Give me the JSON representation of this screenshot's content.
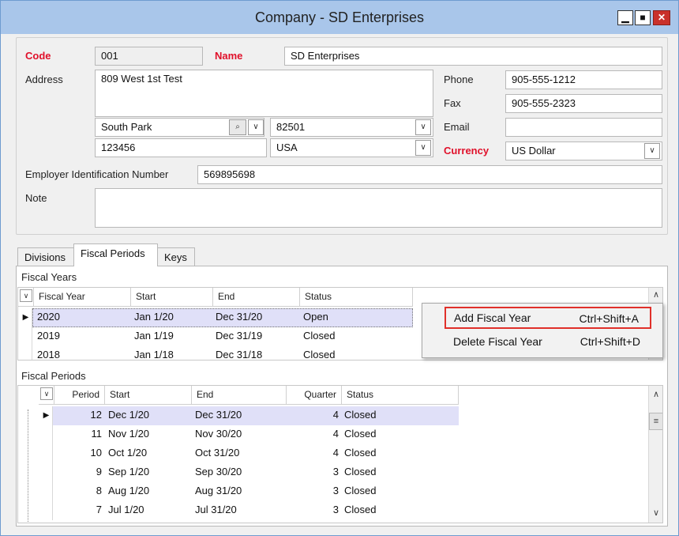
{
  "window": {
    "title": "Company - SD Enterprises",
    "min_glyph": "▁",
    "max_glyph": "■",
    "close_glyph": "✕"
  },
  "form": {
    "code_label": "Code",
    "code_value": "001",
    "name_label": "Name",
    "name_value": "SD Enterprises",
    "address_label": "Address",
    "address_value": "809 West 1st Test",
    "city_value": "South Park",
    "zip_value": "82501",
    "postal_value": "123456",
    "country_value": "USA",
    "phone_label": "Phone",
    "phone_value": "905-555-1212",
    "fax_label": "Fax",
    "fax_value": "905-555-2323",
    "email_label": "Email",
    "email_value": "",
    "currency_label": "Currency",
    "currency_value": "US Dollar",
    "ein_label": "Employer Identification Number",
    "ein_value": "569895698",
    "note_label": "Note",
    "note_value": ""
  },
  "tabs": [
    {
      "label": "Divisions"
    },
    {
      "label": "Fiscal Periods"
    },
    {
      "label": "Keys"
    }
  ],
  "fiscal_years": {
    "title": "Fiscal Years",
    "columns": [
      "Fiscal Year",
      "Start",
      "End",
      "Status"
    ],
    "rows": [
      {
        "year": "2020",
        "start": "Jan 1/20",
        "end": "Dec 31/20",
        "status": "Open"
      },
      {
        "year": "2019",
        "start": "Jan 1/19",
        "end": "Dec 31/19",
        "status": "Closed"
      },
      {
        "year": "2018",
        "start": "Jan 1/18",
        "end": "Dec 31/18",
        "status": "Closed"
      }
    ]
  },
  "fiscal_periods": {
    "title": "Fiscal Periods",
    "columns": [
      "Period",
      "Start",
      "End",
      "Quarter",
      "Status"
    ],
    "rows": [
      {
        "period": "12",
        "start": "Dec 1/20",
        "end": "Dec 31/20",
        "quarter": "4",
        "status": "Closed"
      },
      {
        "period": "11",
        "start": "Nov 1/20",
        "end": "Nov 30/20",
        "quarter": "4",
        "status": "Closed"
      },
      {
        "period": "10",
        "start": "Oct 1/20",
        "end": "Oct 31/20",
        "quarter": "4",
        "status": "Closed"
      },
      {
        "period": "9",
        "start": "Sep 1/20",
        "end": "Sep 30/20",
        "quarter": "3",
        "status": "Closed"
      },
      {
        "period": "8",
        "start": "Aug 1/20",
        "end": "Aug 31/20",
        "quarter": "3",
        "status": "Closed"
      },
      {
        "period": "7",
        "start": "Jul 1/20",
        "end": "Jul 31/20",
        "quarter": "3",
        "status": "Closed"
      }
    ]
  },
  "context_menu": {
    "items": [
      {
        "label": "Add Fiscal Year",
        "shortcut": "Ctrl+Shift+A"
      },
      {
        "label": "Delete Fiscal Year",
        "shortcut": "Ctrl+Shift+D"
      }
    ]
  },
  "colors": {
    "title_bar": "#a9c6ea",
    "required_label": "#e0102a",
    "close_button": "#c9312b",
    "highlight_border": "#e0302a",
    "selected_row": "#e0e0f8"
  }
}
